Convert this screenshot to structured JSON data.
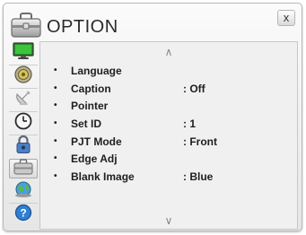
{
  "header": {
    "title": "OPTION",
    "close_label": "x",
    "icon": "briefcase-icon"
  },
  "sidebar": {
    "items": [
      {
        "name": "picture",
        "icon": "monitor-icon"
      },
      {
        "name": "audio",
        "icon": "speaker-icon"
      },
      {
        "name": "setup",
        "icon": "satellite-dish-icon"
      },
      {
        "name": "time",
        "icon": "clock-icon"
      },
      {
        "name": "lock",
        "icon": "lock-icon"
      },
      {
        "name": "option",
        "icon": "briefcase-icon",
        "selected": true
      },
      {
        "name": "network",
        "icon": "globe-icon"
      },
      {
        "name": "support",
        "icon": "question-icon"
      }
    ]
  },
  "panel": {
    "up_arrow": "∧",
    "down_arrow": "∨",
    "bullet": "•",
    "items": [
      {
        "label": "Language",
        "value": ""
      },
      {
        "label": "Caption",
        "value": ": Off"
      },
      {
        "label": "Pointer",
        "value": ""
      },
      {
        "label": "Set ID",
        "value": ": 1"
      },
      {
        "label": "PJT Mode",
        "value": ": Front"
      },
      {
        "label": "Edge Adj",
        "value": ""
      },
      {
        "label": "Blank Image",
        "value": ": Blue"
      }
    ]
  },
  "colors": {
    "panel_bg": "#f0f0f0",
    "window_bg": "#eeeeee",
    "text": "#1e1e1e"
  }
}
